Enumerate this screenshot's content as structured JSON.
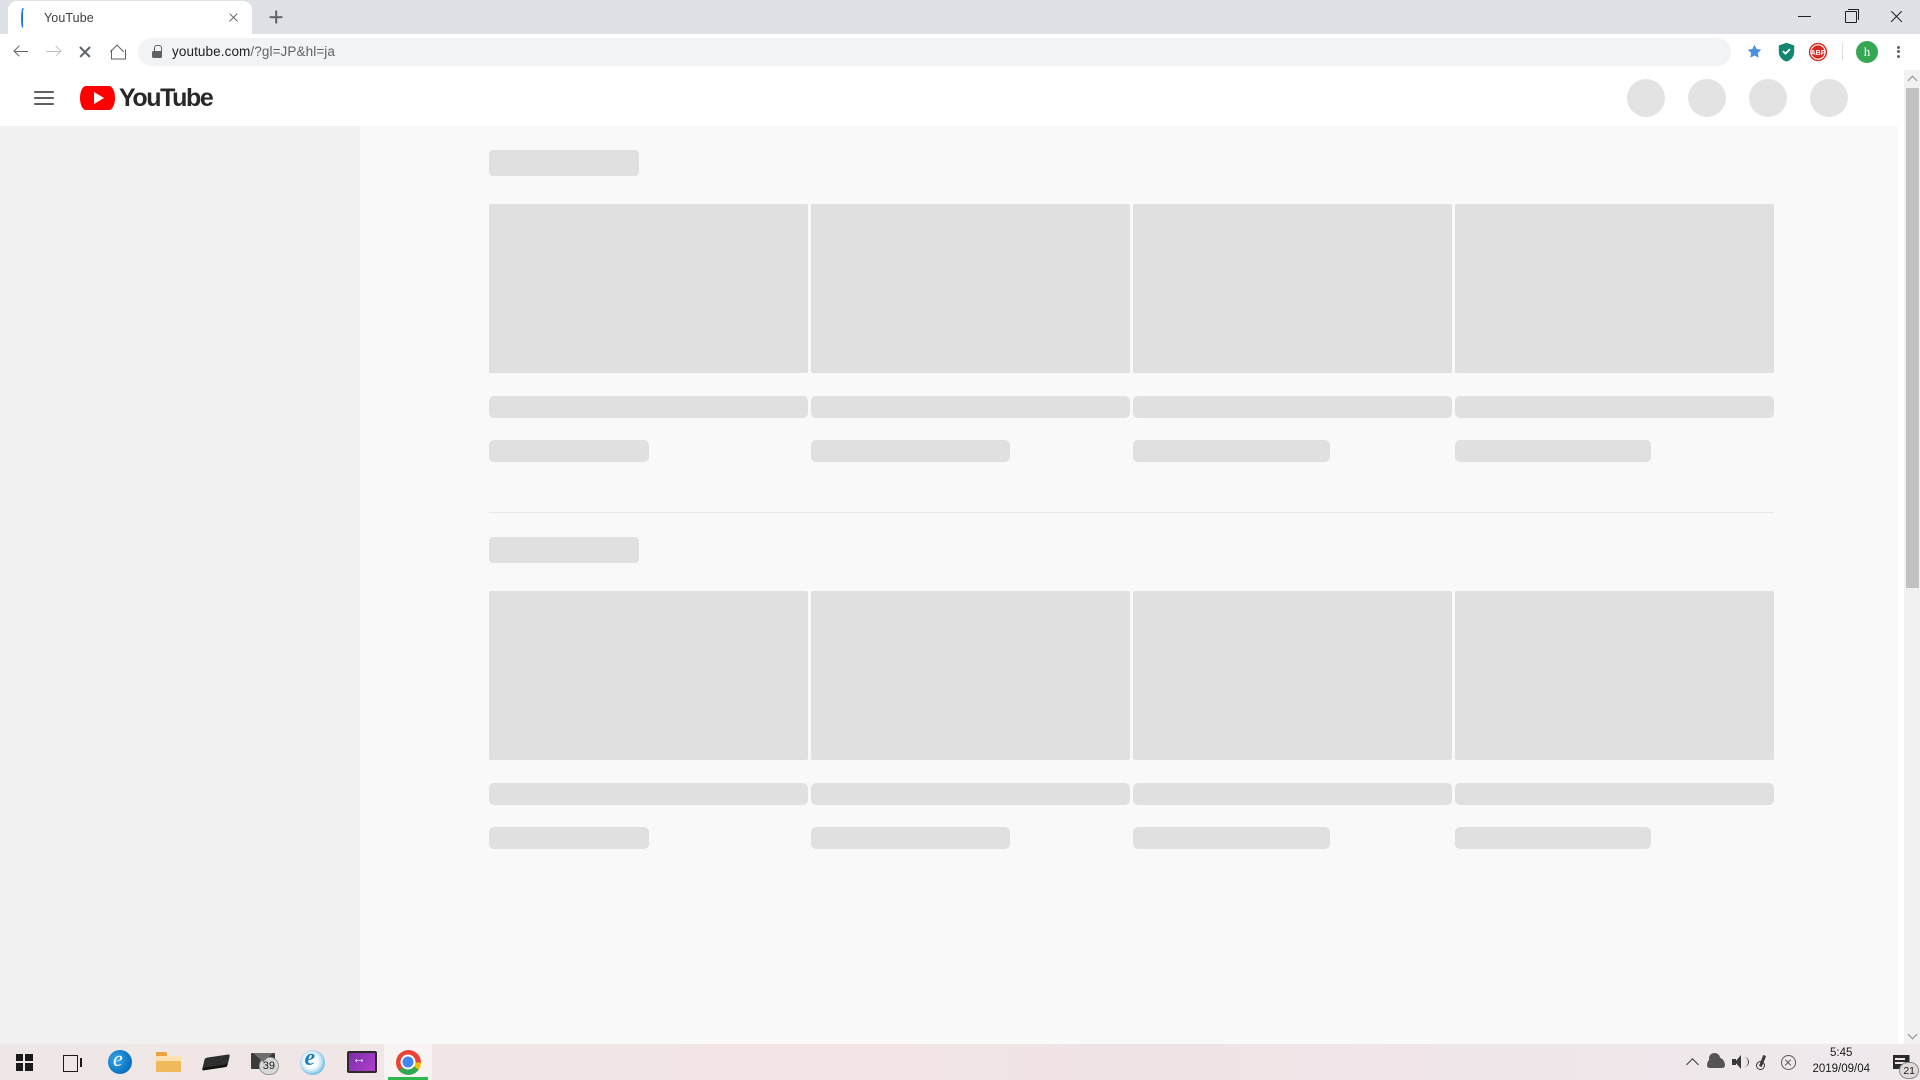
{
  "browser": {
    "tab": {
      "title": "YouTube",
      "favicon_icon": "loading-spinner-icon",
      "close_icon": "close-icon"
    },
    "new_tab_icon": "plus-icon",
    "window_controls": {
      "minimize_icon": "minimize-icon",
      "maximize_icon": "maximize-restore-icon",
      "close_icon": "window-close-icon"
    },
    "toolbar": {
      "back_icon": "arrow-back-icon",
      "forward_icon": "arrow-forward-icon",
      "stop_icon": "stop-loading-icon",
      "home_icon": "home-icon",
      "security_icon": "lock-icon",
      "url_domain": "youtube.com",
      "url_path": "/?gl=JP&hl=ja",
      "bookmark_icon": "star-filled-icon",
      "extensions": [
        {
          "name": "shield-check-icon",
          "color": "#1f9e77"
        },
        {
          "name": "adblock-plus-icon",
          "label": "ABP",
          "color": "#d9271e"
        }
      ],
      "profile_avatar": {
        "initial": "h",
        "color": "#34a853"
      },
      "menu_icon": "three-dot-menu-icon"
    },
    "scrollbar": {
      "up_arrow_icon": "scroll-up-arrow-icon",
      "down_arrow_icon": "scroll-down-arrow-icon",
      "thumb_icon": "scrollbar-thumb"
    }
  },
  "youtube": {
    "masthead": {
      "menu_icon": "hamburger-menu-icon",
      "logo_play_icon": "youtube-play-icon",
      "logo_text": "YouTube",
      "placeholder_count": 4
    },
    "colors": {
      "brand_red": "#ff0000",
      "guide_bg": "#f1f1f1",
      "content_bg": "#f9f9f9",
      "skeleton": "#e0e0e0"
    },
    "shelves": [
      {
        "title_placeholder": true,
        "cards": [
          {
            "line2_width": 160
          },
          {
            "line2_width": 199
          },
          {
            "line2_width": 197
          },
          {
            "line2_width": 196
          }
        ]
      },
      {
        "title_placeholder": true,
        "cards": [
          {
            "line2_width": 160
          },
          {
            "line2_width": 199
          },
          {
            "line2_width": 197
          },
          {
            "line2_width": 196
          }
        ]
      }
    ]
  },
  "taskbar": {
    "start_icon": "windows-start-icon",
    "items": [
      {
        "name": "task-view-icon"
      },
      {
        "name": "microsoft-edge-icon"
      },
      {
        "name": "file-explorer-icon"
      },
      {
        "name": "app-dark-diamond-icon"
      },
      {
        "name": "mail-icon",
        "badge": "39"
      },
      {
        "name": "internet-explorer-icon"
      },
      {
        "name": "display-utility-icon"
      },
      {
        "name": "google-chrome-icon",
        "active": true
      }
    ],
    "tray": {
      "show_hidden_icon": "chevron-up-icon",
      "onedrive_icon": "onedrive-cloud-icon",
      "volume_icon": "speaker-volume-icon",
      "network_icon": "network-pen-icon",
      "status_icon": "circle-x-icon",
      "time": "5:45",
      "date": "2019/09/04",
      "action_center_icon": "action-center-icon",
      "action_center_badge": "21"
    }
  }
}
